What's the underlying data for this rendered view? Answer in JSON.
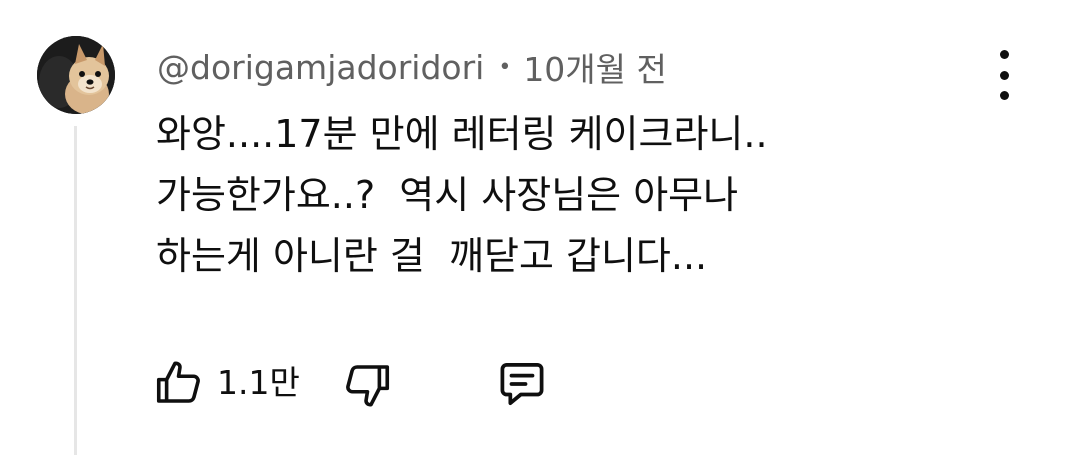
{
  "comment": {
    "author": "@dorigamjadoridori",
    "separator": "•",
    "timestamp": "10개월 전",
    "lines": [
      "와앙....17분 만에 레터링 케이크라니..",
      "가능한가요..?  역시 사장님은 아무나",
      "하는게 아니란 걸  깨닫고 갑니다..."
    ],
    "like_count": "1.1만",
    "avatar_icon": "pomeranian-dog-avatar",
    "actions": {
      "like_icon": "thumbs-up-icon",
      "dislike_icon": "thumbs-down-icon",
      "reply_icon": "reply-comment-icon",
      "more_icon": "more-vertical-icon"
    }
  }
}
